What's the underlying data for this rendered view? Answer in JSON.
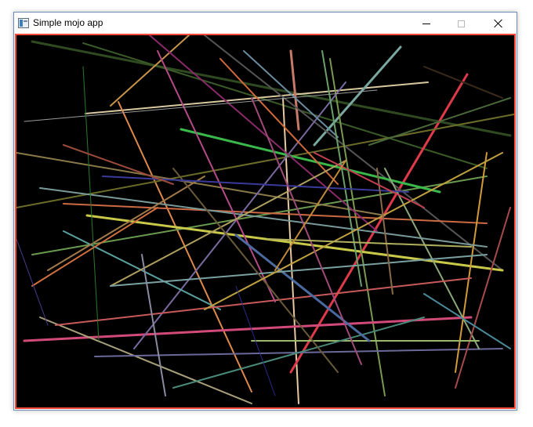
{
  "window": {
    "title": "Simple mojo app",
    "icon": "app-window-icon",
    "controls": {
      "minimize": "minimize-icon",
      "maximize": "maximize-icon",
      "close": "close-icon"
    }
  },
  "canvas": {
    "background": "#000000",
    "border_color": "#ff4a3a"
  }
}
